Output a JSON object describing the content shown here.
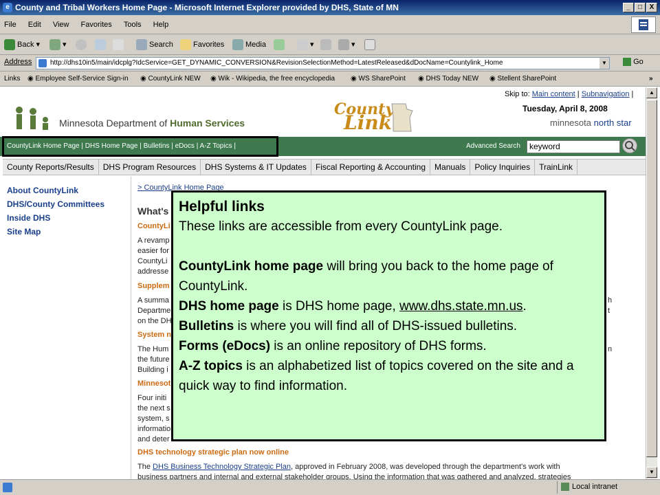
{
  "window": {
    "title": "County and Tribal Workers Home Page - Microsoft Internet Explorer provided by DHS, State of MN",
    "minimize": "_",
    "maximize": "□",
    "close": "X"
  },
  "menubar": [
    "File",
    "Edit",
    "View",
    "Favorites",
    "Tools",
    "Help"
  ],
  "toolbar": {
    "back": "Back",
    "search": "Search",
    "favorites": "Favorites",
    "media": "Media"
  },
  "address": {
    "label": "Address",
    "url": "http://dhs10in5/main/idcplg?IdcService=GET_DYNAMIC_CONVERSION&RevisionSelectionMethod=LatestReleased&dDocName=Countylink_Home",
    "go": "Go"
  },
  "links_bar": {
    "label": "Links",
    "items": [
      "Employee Self-Service Sign-in",
      "CountyLink NEW",
      "Wik - Wikipedia, the free encyclopedia",
      "WS SharePoint",
      "DHS Today NEW",
      "Stellent SharePoint"
    ]
  },
  "header": {
    "skip_to": "Skip to:",
    "main_content": "Main content",
    "subnavigation": "Subnavigation",
    "sep": "|",
    "agency_prefix": "Minnesota Department of",
    "agency_bold": "Human Services",
    "countylink_1": "County",
    "countylink_2": "Link",
    "date": "Tuesday, April 8, 2008",
    "northstar_1": "minnesota",
    "northstar_2": "north star"
  },
  "greenbar": {
    "links": "CountyLink Home Page | DHS Home Page | Bulletins | eDocs | A-Z Topics |",
    "advanced_search": "Advanced Search",
    "keyword_placeholder": "keyword"
  },
  "tabs": [
    "County Reports/Results",
    "DHS Program Resources",
    "DHS Systems & IT Updates",
    "Fiscal Reporting & Accounting",
    "Manuals",
    "Policy Inquiries",
    "TrainLink"
  ],
  "leftnav": [
    "About CountyLink",
    "DHS/County Committees",
    "Inside DHS",
    "Site Map"
  ],
  "content": {
    "breadcrumb": "> CountyLink Home Page",
    "whats": "What's",
    "frag_countylink": "CountyLi",
    "frag_revamp": "A revamp",
    "frag_easier": "easier for",
    "frag_countyli": "CountyLi",
    "frag_address": "addresse",
    "frag_supplem": "Supplem",
    "frag_summary": "A summa",
    "frag_depart": "Departme",
    "frag_onthe": "on the DH",
    "frag_system": "System n",
    "frag_thehum": "The Hum",
    "frag_future": "the future",
    "frag_building": "Building i",
    "frag_minnesota": "Minnesot",
    "frag_four": "Four initi",
    "frag_next": "the next s",
    "frag_system2": "system, s",
    "frag_info": "informatio",
    "frag_deter": "and deter",
    "frag_right1": "h",
    "frag_right2": "n",
    "frag_right3": "t",
    "tech_heading": "DHS technology strategic plan now online",
    "tech_text_pre": "The",
    "tech_link": "DHS Business Technology Strategic Plan",
    "tech_text_post": ", approved in February 2008, was developed through the department's work with",
    "tech_line2": "business partners and internal and external stakeholder groups. Using the information that was gathered and analyzed, strategies"
  },
  "callout": {
    "title": "Helpful links",
    "intro": "These links are accessible from every CountyLink page.",
    "b1": "CountyLink home page",
    "t1": " will bring you back to the home page of CountyLink.",
    "b2": "DHS home page",
    "t2": " is DHS home page, ",
    "url": "www.dhs.state.mn.us",
    "t2end": ".",
    "b3": "Bulletins",
    "t3": " is where you will find all of DHS-issued bulletins.",
    "b4": "Forms (eDocs)",
    "t4": " is an online repository of DHS forms.",
    "b5": "A-Z topics",
    "t5": " is an alphabetized list of topics covered on the site and a quick way to find information."
  },
  "status": {
    "zone": "Local intranet"
  }
}
